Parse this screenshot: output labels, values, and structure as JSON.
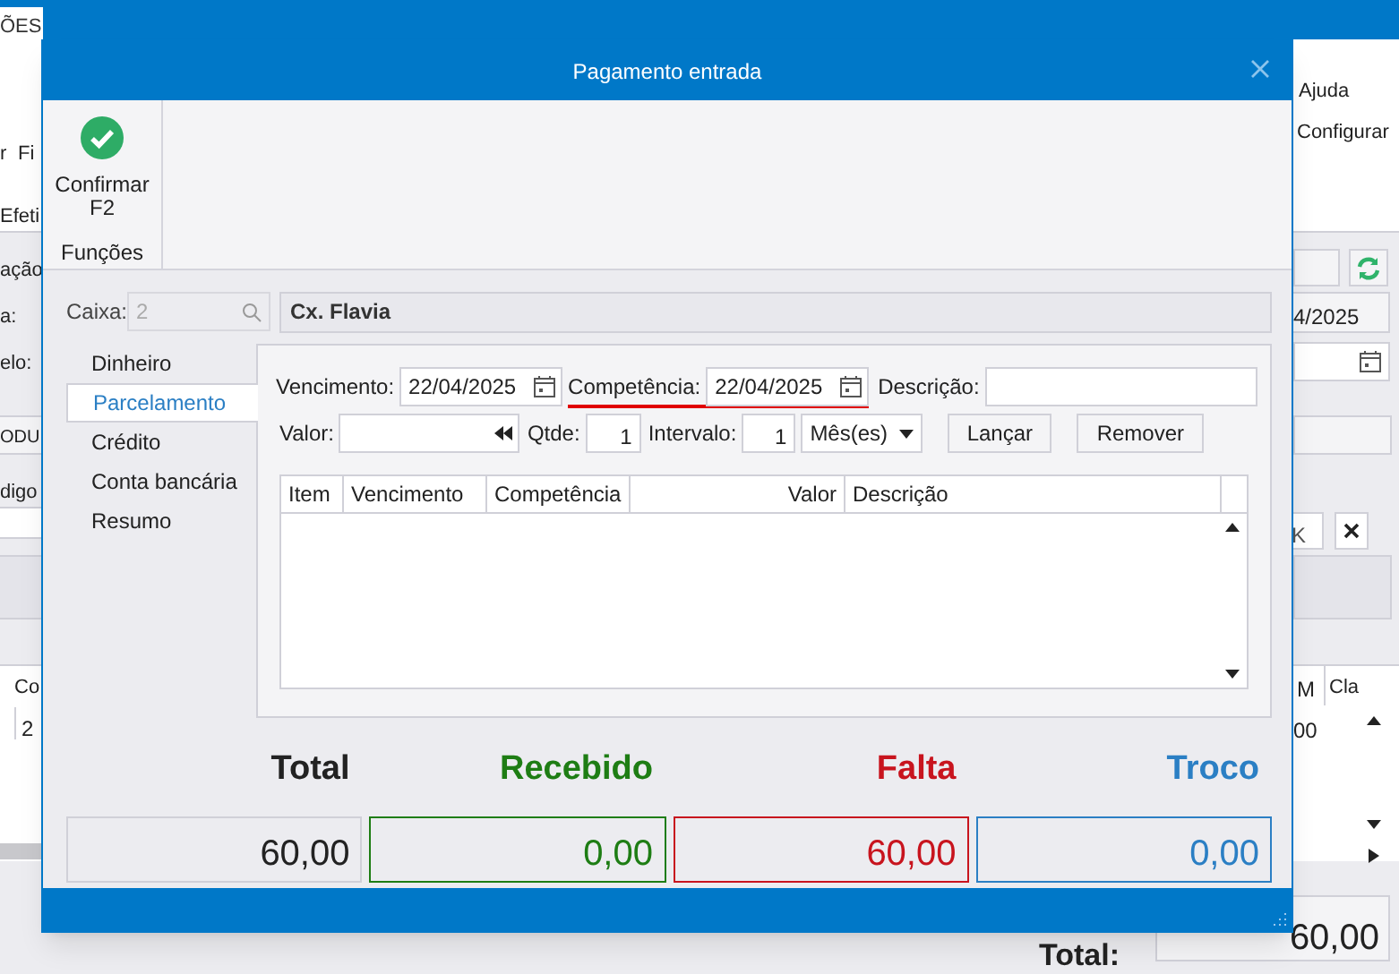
{
  "main_window": {
    "tabs": [
      {
        "label": "ÕES",
        "selected": true
      }
    ],
    "ribbon_left": [
      "r",
      "Fi",
      "Efeti"
    ],
    "ribbon_right": [
      "Ajuda",
      "Configurar"
    ],
    "form_left": [
      "ação",
      "a:",
      "elo:"
    ],
    "section_left": "ODU",
    "field_left": "digo",
    "date_right": "4/2025",
    "grid_left": {
      "header": "Co",
      "cell": "2"
    },
    "grid_right": {
      "headers": [
        "M",
        "Cla"
      ],
      "cell": "00"
    },
    "clear_button_fragment": "K",
    "total": {
      "label": "Total:",
      "value": "60,00"
    }
  },
  "dialog": {
    "title": "Pagamento entrada",
    "ribbon": {
      "button": {
        "label": "Confirmar",
        "shortcut": "F2"
      },
      "group": "Funções"
    },
    "caixa": {
      "label": "Caixa:",
      "value": "2",
      "disabled": true,
      "name": "Cx. Flavia"
    },
    "nav": [
      {
        "label": "Dinheiro",
        "selected": false
      },
      {
        "label": "Parcelamento",
        "selected": true
      },
      {
        "label": "Crédito",
        "selected": false
      },
      {
        "label": "Conta bancária",
        "selected": false
      },
      {
        "label": "Resumo",
        "selected": false
      }
    ],
    "form": {
      "vencimento": {
        "label": "Vencimento:",
        "value": "22/04/2025",
        "underlined": false
      },
      "competencia": {
        "label": "Competência:",
        "value": "22/04/2025",
        "underlined": true
      },
      "descricao": {
        "label": "Descrição:"
      },
      "valor": {
        "label": "Valor:"
      },
      "qtde": {
        "label": "Qtde:",
        "value": "1"
      },
      "intervalo": {
        "label": "Intervalo:",
        "value": "1"
      },
      "unit": {
        "value": "Mês(es)"
      },
      "buttons": [
        "Lançar",
        "Remover"
      ]
    },
    "table": {
      "columns": [
        "Item",
        "Vencimento",
        "Competência",
        "Valor",
        "Descrição"
      ]
    },
    "totals": [
      {
        "label": "Total",
        "value": "60,00",
        "color": "#222222"
      },
      {
        "label": "Recebido",
        "value": "0,00",
        "color": "#1e7d14"
      },
      {
        "label": "Falta",
        "value": "60,00",
        "color": "#c8141e"
      },
      {
        "label": "Troco",
        "value": "0,00",
        "color": "#2b7fc4"
      }
    ]
  }
}
